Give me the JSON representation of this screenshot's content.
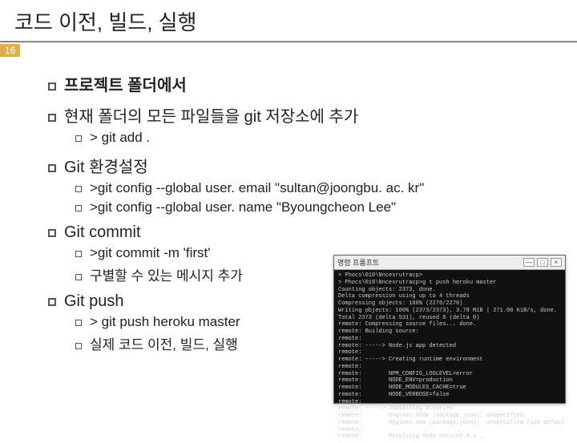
{
  "title": "코드 이전, 빌드, 실행",
  "page_number": "16",
  "sections": [
    {
      "heading": "프로젝트 폴더에서",
      "bold": true,
      "items": []
    },
    {
      "heading": "현재 폴더의 모든 파일들을 git 저장소에 추가",
      "bold": false,
      "items": [
        "> git add ."
      ]
    },
    {
      "heading": "Git 환경설정",
      "bold": false,
      "items": [
        ">git config --global user. email \"sultan@joongbu. ac. kr\"",
        ">git config --global user. name \"Byoungcheon Lee\""
      ]
    },
    {
      "heading": "Git commit",
      "bold": false,
      "items": [
        ">git commit -m 'first'",
        "구별할 수 있는 메시지 추가"
      ]
    },
    {
      "heading": "Git push",
      "bold": false,
      "items": [
        "> git push heroku master",
        "실제 코드 이전, 빌드, 실행"
      ]
    }
  ],
  "terminal": {
    "title": "명령 프롬프트",
    "btn_min": "—",
    "btn_max": "□",
    "btn_close": "×",
    "lines": [
      "> Phocs\\010\\Nncesrutracp>",
      "> Phocs\\018\\Nncesrutracp>g t push heroku master",
      "Counting objects: 2373, done.",
      "Delta compression using up to 4 threads",
      "Compressing objects: 100% (2276/2276)",
      "Writing objects: 100% (2373/2373), 3.78 MiB | 271.00 KiB/s, done.",
      "Total 2373 (delta 531), reused 0 (delta 0)",
      "remote: Compressing source files... done.",
      "remote: Building source:",
      "remote:",
      "remote: -----> Node.js app detected",
      "remote:",
      "remote: -----> Creating runtime environment",
      "remote:",
      "remote:        NPM_CONFIG_LOGLEVEL=error",
      "remote:        NODE_ENV=production",
      "remote:        NODE_MODULES_CACHE=true",
      "remote:        NODE_VERBOSE=false",
      "remote:",
      "remote: -----> Installing binaries",
      "remote:        engines.node (package.json): unspecified",
      "remote:        engines.npm (package.json):  unspecified (use default)",
      "remote:",
      "remote:        Resolving node version 8.x..."
    ]
  }
}
